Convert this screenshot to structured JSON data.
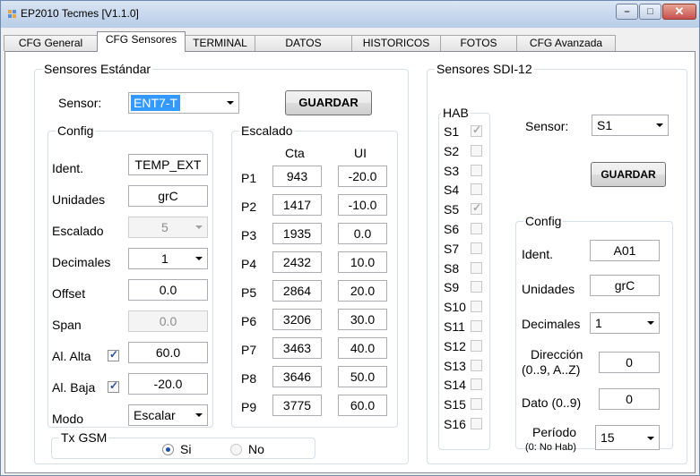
{
  "window": {
    "title": "EP2010 Tecmes  [V1.1.0]",
    "min_glyph": "–",
    "max_glyph": "□",
    "close_glyph": "✕"
  },
  "tabs": [
    {
      "label": "CFG General"
    },
    {
      "label": "CFG Sensores",
      "active": true
    },
    {
      "label": "TERMINAL"
    },
    {
      "label": "DATOS"
    },
    {
      "label": "HISTORICOS"
    },
    {
      "label": "FOTOS"
    },
    {
      "label": "CFG Avanzada"
    }
  ],
  "std": {
    "group_label": "Sensores Estándar",
    "sensor_label": "Sensor:",
    "sensor_value": "ENT7-T",
    "save_label": "GUARDAR",
    "config": {
      "group_label": "Config",
      "ident_label": "Ident.",
      "ident_value": "TEMP_EXT",
      "unidades_label": "Unidades",
      "unidades_value": "grC",
      "escalado_label": "Escalado",
      "escalado_value": "5",
      "decimales_label": "Decimales",
      "decimales_value": "1",
      "offset_label": "Offset",
      "offset_value": "0.0",
      "span_label": "Span",
      "span_value": "0.0",
      "alalta_label": "Al. Alta",
      "alalta_checked": true,
      "alalta_value": "60.0",
      "albaja_label": "Al. Baja",
      "albaja_checked": true,
      "albaja_value": "-20.0",
      "modo_label": "Modo",
      "modo_value": "Escalar"
    },
    "escalado": {
      "group_label": "Escalado",
      "cta_header": "Cta",
      "ui_header": "UI",
      "rows": [
        {
          "p": "P1",
          "cta": "943",
          "ui": "-20.0"
        },
        {
          "p": "P2",
          "cta": "1417",
          "ui": "-10.0"
        },
        {
          "p": "P3",
          "cta": "1935",
          "ui": "0.0"
        },
        {
          "p": "P4",
          "cta": "2432",
          "ui": "10.0"
        },
        {
          "p": "P5",
          "cta": "2864",
          "ui": "20.0"
        },
        {
          "p": "P6",
          "cta": "3206",
          "ui": "30.0"
        },
        {
          "p": "P7",
          "cta": "3463",
          "ui": "40.0"
        },
        {
          "p": "P8",
          "cta": "3646",
          "ui": "50.0"
        },
        {
          "p": "P9",
          "cta": "3775",
          "ui": "60.0"
        }
      ]
    },
    "txgsm": {
      "group_label": "Tx GSM",
      "si_label": "Si",
      "si_selected": true,
      "no_label": "No",
      "no_selected": false
    }
  },
  "sdi": {
    "group_label": "Sensores SDI-12",
    "hab": {
      "group_label": "HAB",
      "items": [
        {
          "label": "S1",
          "checked": true
        },
        {
          "label": "S2",
          "checked": false
        },
        {
          "label": "S3",
          "checked": false
        },
        {
          "label": "S4",
          "checked": false
        },
        {
          "label": "S5",
          "checked": true
        },
        {
          "label": "S6",
          "checked": false
        },
        {
          "label": "S7",
          "checked": false
        },
        {
          "label": "S8",
          "checked": false
        },
        {
          "label": "S9",
          "checked": false
        },
        {
          "label": "S10",
          "checked": false
        },
        {
          "label": "S11",
          "checked": false
        },
        {
          "label": "S12",
          "checked": false
        },
        {
          "label": "S13",
          "checked": false
        },
        {
          "label": "S14",
          "checked": false
        },
        {
          "label": "S15",
          "checked": false
        },
        {
          "label": "S16",
          "checked": false
        }
      ]
    },
    "sensor_label": "Sensor:",
    "sensor_value": "S1",
    "save_label": "GUARDAR",
    "config": {
      "group_label": "Config",
      "ident_label": "Ident.",
      "ident_value": "A01",
      "unidades_label": "Unidades",
      "unidades_value": "grC",
      "decimales_label": "Decimales",
      "decimales_value": "1",
      "direccion_label": "Dirección",
      "direccion_sub": "(0..9, A..Z)",
      "direccion_value": "0",
      "dato_label": "Dato (0..9)",
      "dato_value": "0",
      "periodo_label": "Período",
      "periodo_sub": "(0: No Hab)",
      "periodo_value": "15"
    }
  },
  "colors": {
    "selection": "#3399ff",
    "titlebar": "#c9d9ee",
    "close_button": "#c75050"
  }
}
